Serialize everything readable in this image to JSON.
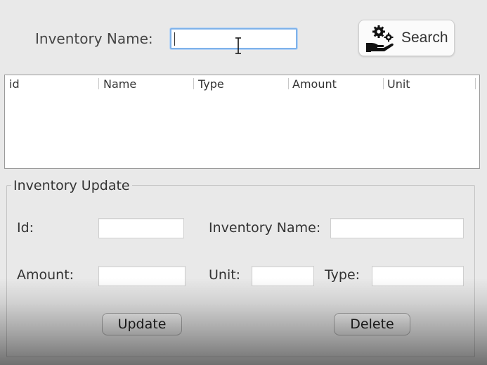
{
  "search": {
    "label": "Inventory Name:",
    "input_value": "",
    "button_label": "Search",
    "button_icon": "hand-gears-icon"
  },
  "table": {
    "columns": [
      "id",
      "Name",
      "Type",
      "Amount",
      "Unit"
    ],
    "rows": []
  },
  "update_panel": {
    "title": "Inventory Update",
    "id_label": "Id:",
    "id_value": "",
    "inventory_name_label": "Inventory Name:",
    "inventory_name_value": "",
    "amount_label": "Amount:",
    "amount_value": "",
    "unit_label": "Unit:",
    "unit_value": "",
    "type_label": "Type:",
    "type_value": "",
    "update_button": "Update",
    "delete_button": "Delete"
  },
  "colors": {
    "background": "#e9e9e9",
    "focus_ring": "#7fb2ea"
  }
}
